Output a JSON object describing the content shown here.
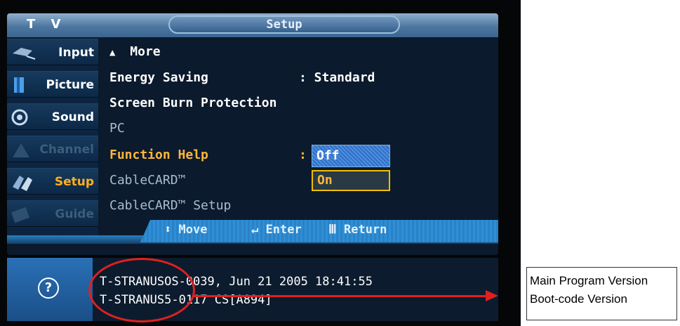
{
  "header": {
    "tv_label": "T V",
    "title": "Setup"
  },
  "nav": [
    {
      "label": "Input",
      "icon": "input-icon",
      "state": "normal"
    },
    {
      "label": "Picture",
      "icon": "picture-icon",
      "state": "normal"
    },
    {
      "label": "Sound",
      "icon": "sound-icon",
      "state": "normal"
    },
    {
      "label": "Channel",
      "icon": "channel-icon",
      "state": "dim"
    },
    {
      "label": "Setup",
      "icon": "setup-icon",
      "state": "active"
    },
    {
      "label": "Guide",
      "icon": "guide-icon",
      "state": "dim"
    }
  ],
  "menu": {
    "more": "More",
    "energy_saving": {
      "label": "Energy Saving",
      "value": ": Standard"
    },
    "screen_burn": "Screen Burn Protection",
    "pc": "PC",
    "function_help": {
      "label": "Function Help",
      "colon": ":",
      "option_off": "Off",
      "option_on": "On"
    },
    "cablecard": "CableCARD™",
    "cablecard_setup": "CableCARD™ Setup"
  },
  "helpbar": {
    "move": "Move",
    "enter": "Enter",
    "return": "Return"
  },
  "info": {
    "help_symbol": "?",
    "main_version": "T-STRANUSOS-0039, Jun 21 2005 18:41:55",
    "boot_version": "T-STRANUS5-0117 CS[A894]"
  },
  "annotation": {
    "line1": "Main Program Version",
    "line2": "Boot-code Version"
  },
  "colors": {
    "accent_orange": "#ffb63a",
    "annotation_red": "#e02020",
    "osd_blue": "#2a82c6"
  }
}
